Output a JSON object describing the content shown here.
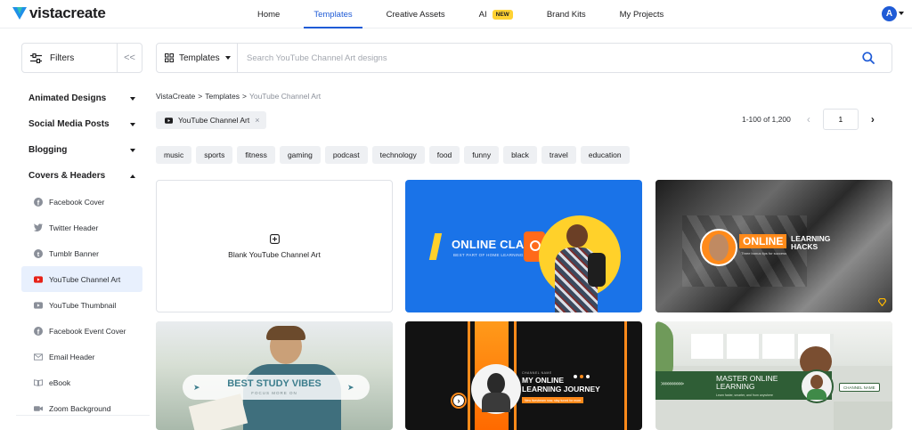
{
  "brand": {
    "name": "vistacreate"
  },
  "nav": {
    "items": [
      {
        "label": "Home"
      },
      {
        "label": "Templates"
      },
      {
        "label": "Creative Assets"
      },
      {
        "label": "AI",
        "badge": "NEW"
      },
      {
        "label": "Brand Kits"
      },
      {
        "label": "My Projects"
      }
    ],
    "active": "Templates"
  },
  "user": {
    "initial": "A"
  },
  "filters": {
    "label": "Filters",
    "collapse": "<<"
  },
  "search": {
    "scope": "Templates",
    "placeholder": "Search YouTube Channel Art designs"
  },
  "sidebar": {
    "categories": [
      {
        "label": "Animated Designs",
        "expanded": false
      },
      {
        "label": "Social Media Posts",
        "expanded": false
      },
      {
        "label": "Blogging",
        "expanded": false
      },
      {
        "label": "Covers & Headers",
        "expanded": true
      }
    ],
    "subitems": [
      {
        "label": "Facebook Cover",
        "icon": "facebook-icon"
      },
      {
        "label": "Twitter Header",
        "icon": "twitter-icon"
      },
      {
        "label": "Tumblr Banner",
        "icon": "tumblr-icon"
      },
      {
        "label": "YouTube Channel Art",
        "icon": "youtube-icon",
        "active": true
      },
      {
        "label": "YouTube Thumbnail",
        "icon": "youtube-icon"
      },
      {
        "label": "Facebook Event Cover",
        "icon": "facebook-icon"
      },
      {
        "label": "Email Header",
        "icon": "mail-icon"
      },
      {
        "label": "eBook",
        "icon": "book-icon"
      },
      {
        "label": "Zoom Background",
        "icon": "video-camera-icon"
      }
    ]
  },
  "breadcrumb": [
    "VistaCreate",
    "Templates",
    "YouTube Channel Art"
  ],
  "breadcrumb_sep": ">",
  "active_filter": {
    "label": "YouTube Channel Art",
    "remove": "×"
  },
  "pagination": {
    "range": "1-100 of 1,200",
    "page": "1"
  },
  "tags": [
    "music",
    "sports",
    "fitness",
    "gaming",
    "podcast",
    "technology",
    "food",
    "funny",
    "black",
    "travel",
    "education"
  ],
  "blank_card": {
    "label": "Blank YouTube Channel Art"
  },
  "templates": [
    {
      "title": "ONLINE CLASS",
      "subtitle": "BEST PART OF HOME LEARNING"
    },
    {
      "title_a": "ONLINE",
      "title_b": "LEARNING HACKS",
      "subtitle": "Three bonus tips for success"
    },
    {
      "title": "BEST STUDY VIBES",
      "subtitle": "FOCUS MORE ON"
    },
    {
      "kicker": "CHANNEL NAME",
      "title": "MY ONLINE LEARNING JOURNEY",
      "subtitle": "New livestream now, stay tuned for more"
    },
    {
      "title": "MASTER ONLINE LEARNING",
      "subtitle": "Learn faster, smarter, and from anywhere",
      "channel": "CHANNEL NAME"
    }
  ],
  "colors": {
    "accent": "#1f5bd6",
    "active_bg": "#e8f0fd",
    "new_badge": "#ffd233",
    "card_blue": "#1a73e8",
    "card_yellow": "#ffd12a",
    "card_orange": "#ff6a1a"
  }
}
